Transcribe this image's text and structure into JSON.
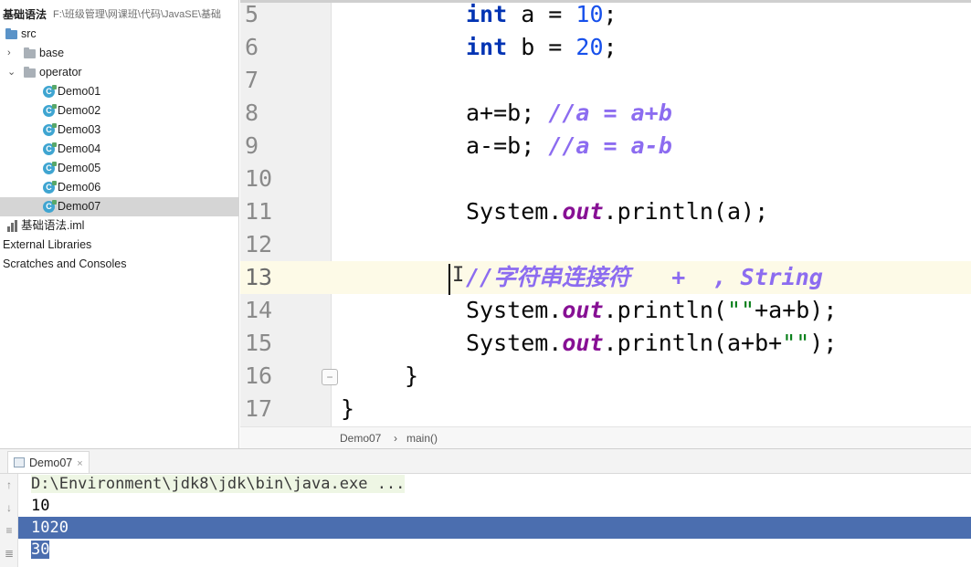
{
  "project": {
    "root_name": "基础语法",
    "root_path": "F:\\班级管理\\网课班\\代码\\JavaSE\\基础",
    "items": [
      {
        "label": "src",
        "kind": "folder"
      },
      {
        "label": "base",
        "kind": "package",
        "arrow": "›"
      },
      {
        "label": "operator",
        "kind": "package",
        "arrow": "⌄"
      },
      {
        "label": "Demo01",
        "kind": "class"
      },
      {
        "label": "Demo02",
        "kind": "class"
      },
      {
        "label": "Demo03",
        "kind": "class"
      },
      {
        "label": "Demo04",
        "kind": "class"
      },
      {
        "label": "Demo05",
        "kind": "class"
      },
      {
        "label": "Demo06",
        "kind": "class"
      },
      {
        "label": "Demo07",
        "kind": "class",
        "selected": true
      },
      {
        "label": "基础语法.iml",
        "kind": "iml"
      },
      {
        "label": "External Libraries",
        "kind": "text"
      },
      {
        "label": "Scratches and Consoles",
        "kind": "text"
      }
    ]
  },
  "editor": {
    "lines": [
      {
        "num": "5",
        "tokens": [
          {
            "t": "int",
            "c": "kw"
          },
          {
            "t": " a = "
          },
          {
            "t": "10",
            "c": "num"
          },
          {
            "t": ";"
          }
        ]
      },
      {
        "num": "6",
        "tokens": [
          {
            "t": "int",
            "c": "kw"
          },
          {
            "t": " b = "
          },
          {
            "t": "20",
            "c": "num"
          },
          {
            "t": ";"
          }
        ]
      },
      {
        "num": "7",
        "tokens": []
      },
      {
        "num": "8",
        "tokens": [
          {
            "t": "a+=b; "
          },
          {
            "t": "//a = a+b",
            "c": "cmt"
          }
        ]
      },
      {
        "num": "9",
        "tokens": [
          {
            "t": "a-=b; "
          },
          {
            "t": "//a = a-b",
            "c": "cmt"
          }
        ]
      },
      {
        "num": "10",
        "tokens": []
      },
      {
        "num": "11",
        "tokens": [
          {
            "t": "System."
          },
          {
            "t": "out",
            "c": "field"
          },
          {
            "t": ".println(a);"
          }
        ]
      },
      {
        "num": "12",
        "tokens": []
      },
      {
        "num": "13",
        "tokens": [
          {
            "t": "//字符串连接符   +  , String",
            "c": "cmt"
          }
        ],
        "current": true
      },
      {
        "num": "14",
        "tokens": [
          {
            "t": "System."
          },
          {
            "t": "out",
            "c": "field"
          },
          {
            "t": ".println("
          },
          {
            "t": "\"\"",
            "c": "str"
          },
          {
            "t": "+a+b);"
          }
        ]
      },
      {
        "num": "15",
        "tokens": [
          {
            "t": "System."
          },
          {
            "t": "out",
            "c": "field"
          },
          {
            "t": ".println(a+b+"
          },
          {
            "t": "\"\"",
            "c": "str"
          },
          {
            "t": ");"
          }
        ]
      },
      {
        "num": "16",
        "tokens": [
          {
            "t": "}"
          }
        ],
        "indent": "method"
      },
      {
        "num": "17",
        "tokens": [
          {
            "t": "}"
          }
        ],
        "indent": "class"
      }
    ]
  },
  "breadcrumb": {
    "class_name": "Demo07",
    "separator": "›",
    "method": "main()"
  },
  "run": {
    "tab_label": "Demo07",
    "close_glyph": "×",
    "output": [
      {
        "text": "D:\\Environment\\jdk8\\jdk\\bin\\java.exe ...",
        "style": "cmd"
      },
      {
        "text": "10",
        "style": "plain"
      },
      {
        "text": "1020",
        "style": "sel"
      },
      {
        "text": "30",
        "style": "sel-part"
      }
    ]
  },
  "colors": {
    "keyword": "#0033b3",
    "number": "#1750eb",
    "comment": "#8c6cf0",
    "field": "#871094",
    "string": "#067d17",
    "selection": "#4b6eaf",
    "current_line": "#fdfae7"
  }
}
